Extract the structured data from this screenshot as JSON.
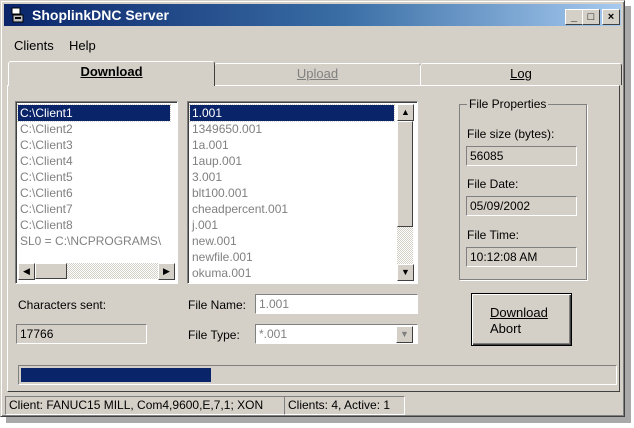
{
  "window": {
    "title": "ShoplinkDNC Server",
    "icon": "app-icon"
  },
  "titlebar_buttons": {
    "minimize": "_",
    "maximize": "□",
    "close": "×"
  },
  "menu": [
    "Clients",
    "Help"
  ],
  "tabs": [
    {
      "label": "Download",
      "active": true,
      "enabled": true
    },
    {
      "label": "Upload",
      "active": false,
      "enabled": false
    },
    {
      "label": "Log",
      "active": false,
      "enabled": true
    }
  ],
  "clients_list": {
    "items": [
      "C:\\Client1",
      "C:\\Client2",
      "C:\\Client3",
      "C:\\Client4",
      "C:\\Client5",
      "C:\\Client6",
      "C:\\Client7",
      "C:\\Client8",
      "SL0 = C:\\NCPROGRAMS\\"
    ],
    "selected_index": 0
  },
  "files_list": {
    "items": [
      "1.001",
      "1349650.001",
      "1a.001",
      "1aup.001",
      "3.001",
      "blt100.001",
      "cheadpercent.001",
      "j.001",
      "new.001",
      "newfile.001",
      "okuma.001"
    ],
    "selected_index": 0
  },
  "characters_sent": {
    "label": "Characters sent:",
    "value": "17766"
  },
  "file_name": {
    "label": "File Name:",
    "value": "1.001"
  },
  "file_type": {
    "label": "File Type:",
    "value": "*.001"
  },
  "file_properties": {
    "title": "File Properties",
    "size_label": "File size (bytes):",
    "size_value": "56085",
    "date_label": "File Date:",
    "date_value": "05/09/2002",
    "time_label": "File Time:",
    "time_value": "10:12:08 AM"
  },
  "download_button": {
    "line1": "Download",
    "line2": "Abort"
  },
  "progress": {
    "fraction": 0.32
  },
  "status": {
    "client": "Client: FANUC15 MILL, Com4,9600,E,7,1; XON",
    "clients": "Clients: 4, Active: 1"
  },
  "colors": {
    "face": "#d4d0c8",
    "selection": "#0a246a",
    "title_start": "#0a246a",
    "title_end": "#a6caf0"
  }
}
